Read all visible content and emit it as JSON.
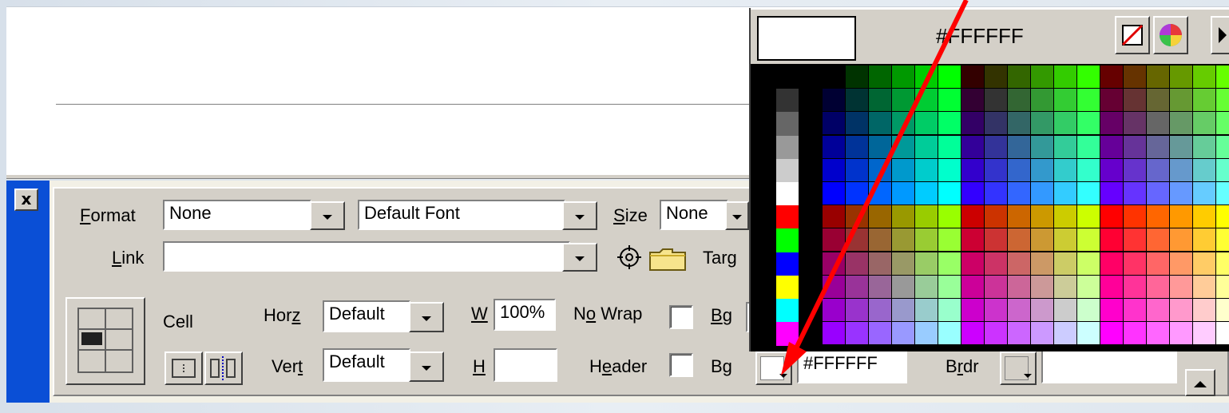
{
  "panel": {
    "close_label": "x",
    "format_label": "Format",
    "format_value": "None",
    "font_value": "Default Font",
    "size_label": "Size",
    "size_value": "None",
    "link_label": "Link",
    "link_value": "",
    "target_label": "Targ",
    "cell_label": "Cell",
    "horz_label": "Horz",
    "horz_value": "Default",
    "vert_label": "Vert",
    "vert_value": "Default",
    "w_label": "W",
    "w_value": "100%",
    "h_label": "H",
    "h_value": "",
    "nowrap_label": "No Wrap",
    "header_label": "Header",
    "bg_label_top": "Bg",
    "bg_label_bottom": "Bg",
    "bg_value": "#FFFFFF",
    "brdr_label": "Brdr",
    "brdr_value": ""
  },
  "picker": {
    "hex": "#FFFFFF",
    "selected_color": "#FFFFFF"
  },
  "colors": {
    "accent_blue": "#0A4FD6",
    "arrow_red": "#FF0000",
    "panel_gray": "#D4D0C8"
  },
  "icons": [
    "close-icon",
    "point-to-file-icon",
    "folder-icon",
    "table-cell-icon",
    "merge-cells-icon",
    "split-cell-icon",
    "no-color-icon",
    "color-wheel-icon",
    "picker-menu-icon",
    "expand-arrow-icon"
  ]
}
